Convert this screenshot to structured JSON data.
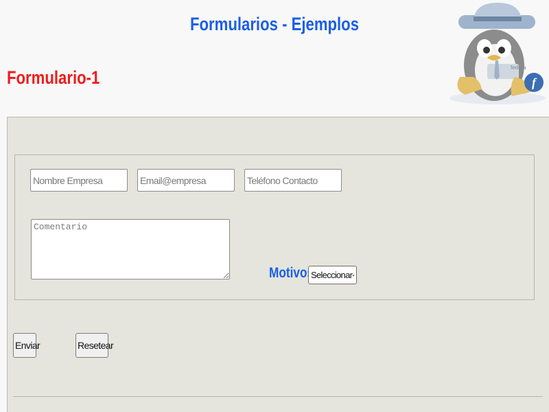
{
  "header": {
    "title": "Formularios - Ejemplos",
    "mascot_icon": "fedora-tux-detective-icon",
    "mascot_badge": "fedora"
  },
  "form": {
    "title": "Formulario-1",
    "fields": {
      "company_placeholder": "Nombre Empresa",
      "email_placeholder": "Email@empresa",
      "phone_placeholder": "Teléfono Contacto",
      "comment_placeholder": "Comentario"
    },
    "motivos": {
      "label": "Motivos",
      "selected": "Seleccionar"
    },
    "buttons": {
      "submit": "Enviar",
      "reset": "Resetear"
    }
  },
  "colors": {
    "heading_blue": "#1a5fe6",
    "heading_red": "#ee1c1c",
    "panel_bg": "#e5e5dd"
  }
}
